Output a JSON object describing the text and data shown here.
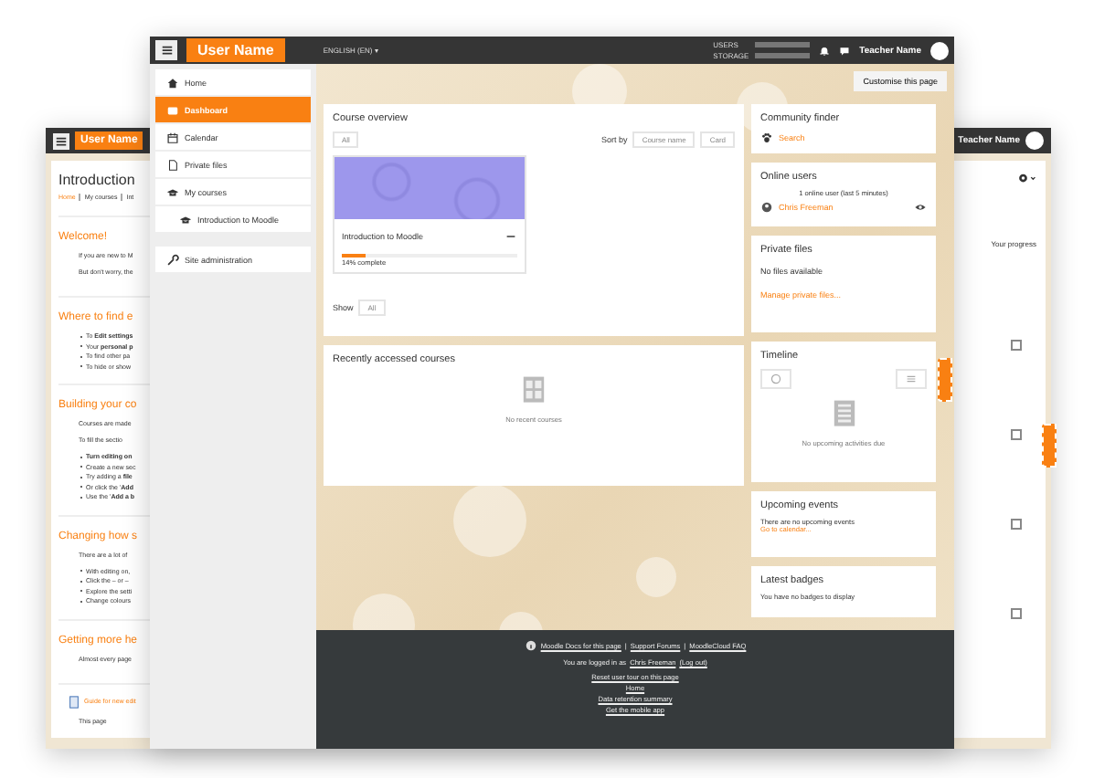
{
  "back_window": {
    "header": {
      "user_name": "User Name",
      "teacher_name": "Teacher Name"
    },
    "title": "Introduction",
    "breadcrumb": [
      "Home",
      "My courses",
      "Int"
    ],
    "sections": [
      {
        "heading": "Welcome!",
        "paragraphs": [
          "If you are new to M",
          "But don't worry, the"
        ]
      },
      {
        "heading": "Where to find e",
        "bullets": [
          "To **Edit settings**",
          "Your **personal p**",
          "To find other pa",
          "To hide or show"
        ]
      },
      {
        "heading": "Building your co",
        "paragraphs": [
          "Courses are made",
          "To fill the sectio"
        ],
        "bullets": [
          "**Turn editing on**",
          "Create a new sec",
          "Try adding a **file**",
          "Or click the '**Add**",
          "Use the '**Add a b**"
        ]
      },
      {
        "heading": "Changing how s",
        "paragraphs": [
          "There are a lot of"
        ],
        "bullets": [
          "With editing on,",
          "Click the – or –",
          "Explore the setti",
          "Change colours"
        ]
      },
      {
        "heading": "Getting more he",
        "paragraphs": [
          "Almost every page"
        ]
      }
    ],
    "guide_link": "Guide for new edit",
    "last_line": "This page",
    "progress_label": "Your progress",
    "activities": [
      {
        "checked": false
      },
      {
        "checked": false
      },
      {
        "checked": false
      },
      {
        "checked": false
      }
    ]
  },
  "front_window": {
    "header": {
      "user_name": "User Name",
      "language": "ENGLISH (EN) ▾",
      "quota": [
        "USERS",
        "STORAGE"
      ],
      "teacher_name": "Teacher Name"
    },
    "sidebar": {
      "items": [
        {
          "label": "Home",
          "selected": false
        },
        {
          "label": "Dashboard",
          "selected": true
        },
        {
          "label": "Calendar",
          "selected": false
        },
        {
          "label": "Private files",
          "selected": false
        },
        {
          "label": "My courses",
          "selected": false,
          "children": [
            {
              "label": "Introduction to Moodle",
              "selected": false
            }
          ]
        }
      ],
      "admin_items": [
        {
          "label": "Site administration",
          "selected": false
        }
      ]
    },
    "customise_button": "Customise this page",
    "course_overview": {
      "title": "Course overview",
      "filter": "All",
      "sort_label": "Sort by",
      "sort_buttons": [
        "Course name",
        "Card"
      ],
      "courses": [
        {
          "name": "Introduction to Moodle",
          "progress": "14% complete",
          "level": 0.14
        }
      ],
      "show_label": "Show",
      "show_value": "All"
    },
    "recent": {
      "title": "Recently accessed courses",
      "empty": "No recent courses"
    },
    "blocks": [
      {
        "kind": "finder",
        "title": "Community finder",
        "link": "Search"
      },
      {
        "kind": "online",
        "title": "Online users",
        "note": "1 online user (last 5 minutes)",
        "user": "Chris Freeman"
      },
      {
        "kind": "files",
        "title": "Private files",
        "note": "No files available",
        "link": "Manage private files..."
      },
      {
        "kind": "timeline",
        "title": "Timeline",
        "note": "No upcoming activities due"
      },
      {
        "kind": "events",
        "title": "Upcoming events",
        "note": "There are no upcoming events",
        "link": "Go to calendar..."
      },
      {
        "kind": "badges",
        "title": "Latest badges",
        "note": "You have no badges to display"
      }
    ],
    "footer": {
      "help_links": [
        "Moodle Docs for this page",
        "Support Forums",
        "MoodleCloud FAQ"
      ],
      "separator": "|",
      "login_text": "You are logged in as",
      "login_user": "Chris Freeman",
      "logout": "(Log out)",
      "links": [
        "Reset user tour on this page",
        "Home",
        "Data retention summary",
        "Get the mobile app"
      ]
    }
  }
}
